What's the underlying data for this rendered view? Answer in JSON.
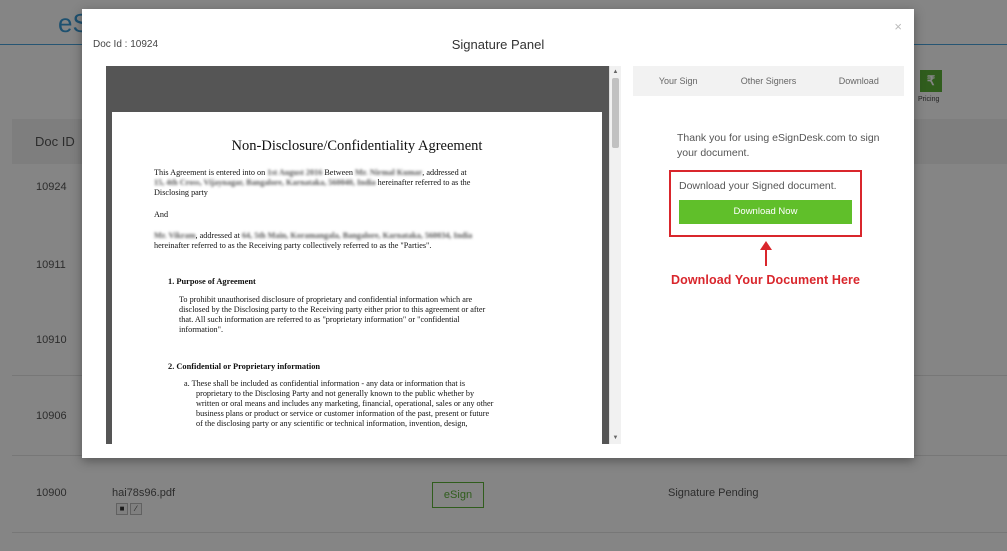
{
  "background": {
    "logo": "eS",
    "pricing_icon": "₹",
    "pricing_label": "Pricing",
    "table_header_docid": "Doc ID",
    "rows": [
      {
        "doc_id": "10924"
      },
      {
        "doc_id": "10911"
      },
      {
        "doc_id": "10910"
      },
      {
        "doc_id": "10906"
      },
      {
        "doc_id": "10900",
        "file": "hai78s96.pdf",
        "action": "eSign",
        "status": "Signature Pending"
      }
    ],
    "colors": {
      "accent": "#5cb338",
      "link_blue": "#3a9bd6"
    }
  },
  "modal": {
    "doc_id": "Doc Id : 10924",
    "title": "Signature Panel",
    "close": "×",
    "document": {
      "title": "Non-Disclosure/Confidentiality Agreement",
      "p1_a": "This Agreement is entered into on",
      "p1_b": "Between",
      "p1_c": ", addressed at",
      "p1_d": "hereinafter referred to as the",
      "p1_e": "Disclosing party",
      "and": "And",
      "p2_a": ", addressed at",
      "p2_b": "hereinafter referred to as the Receiving party collectively referred to as the \"Parties\".",
      "h1": "1.  Purpose of Agreement",
      "s1": [
        "To prohibit unauthorised disclosure of proprietary and confidential information which are",
        "disclosed by the Disclosing party to the Receiving party either prior to this agreement or after",
        "that. All such information are referred to as \"proprietary information\" or \"confidential",
        "information\"."
      ],
      "h2": "2.  Confidential or Proprietary information",
      "s2": [
        "a.  These shall be included as confidential information - any data or information that is",
        "proprietary to the Disclosing Party and not generally known to the public whether by",
        "written or oral means and includes any marketing, financial, operational, sales or any other",
        "business plans or product or service or customer information of the past, present or future",
        "of the disclosing party or any scientific or technical information, invention, design,"
      ]
    },
    "tabs": [
      "Your Sign",
      "Other Signers",
      "Download"
    ],
    "thanks": "Thank you for using eSignDesk.com to sign your document.",
    "download_text": "Download your Signed document.",
    "download_button": "Download Now",
    "annotation": "Download Your Document Here",
    "colors": {
      "button_green": "#60bf2a",
      "annotation_red": "#d9262c"
    }
  }
}
